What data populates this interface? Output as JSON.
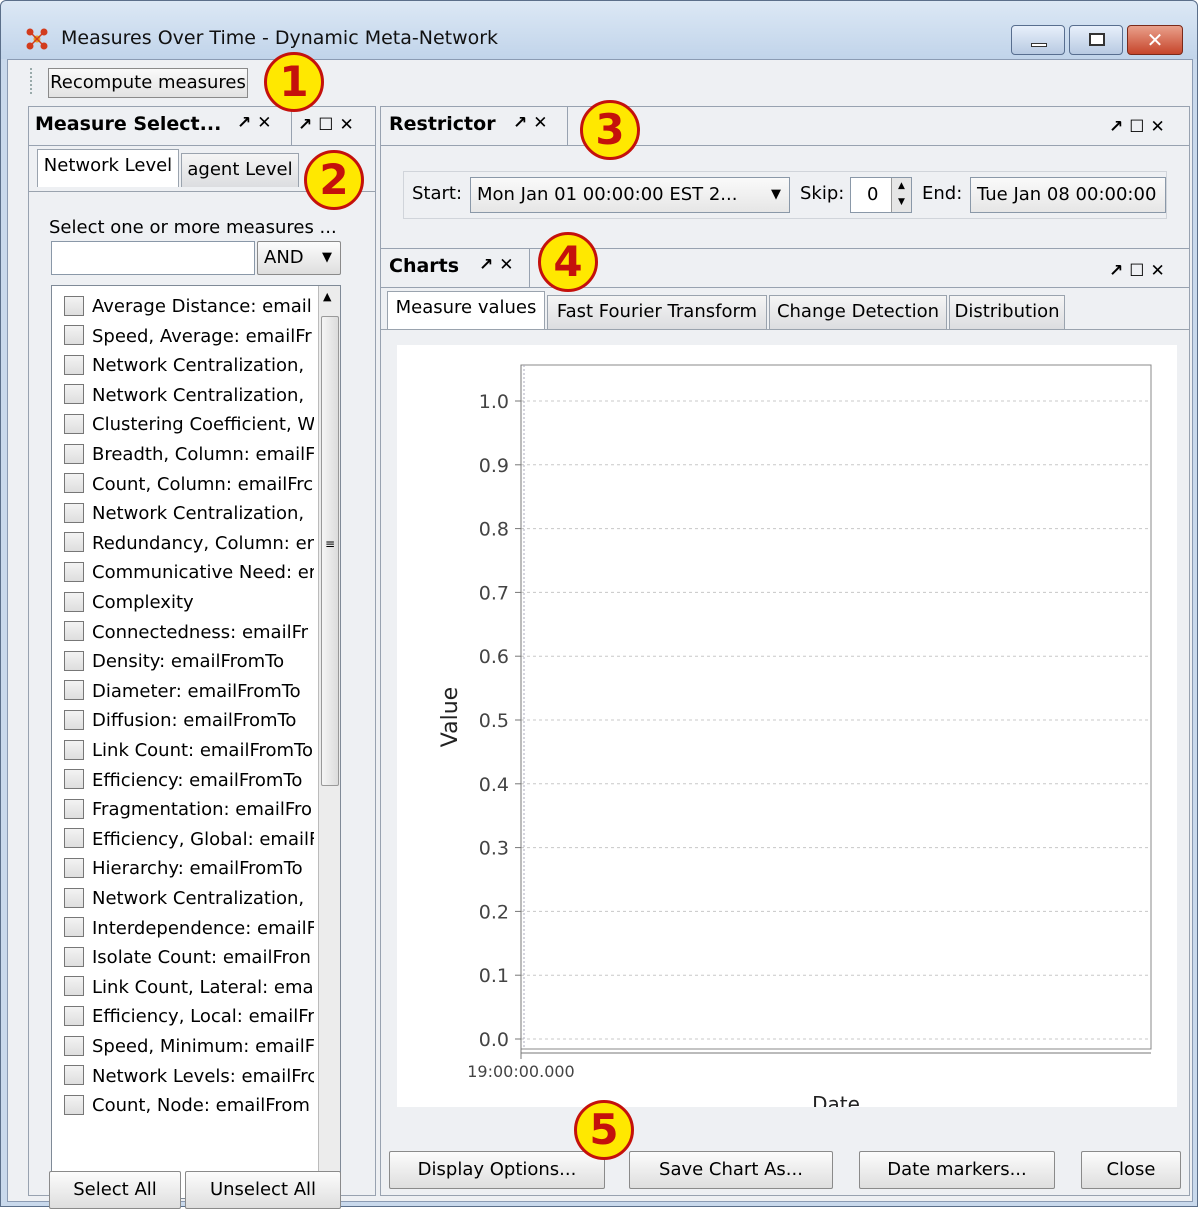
{
  "window": {
    "title": "Measures Over Time - Dynamic Meta-Network",
    "minimize_icon": "minimize-icon",
    "maximize_icon": "maximize-icon",
    "close_icon": "close-icon"
  },
  "toolbar": {
    "recompute_label": "Recompute measures"
  },
  "badges": [
    "1",
    "2",
    "3",
    "4",
    "5"
  ],
  "measure_panel": {
    "title": "Measure Select...",
    "tabs": [
      "Network Level",
      "agent Level"
    ],
    "hint": "Select one or more measures ...",
    "filter_value": "",
    "operator": "AND",
    "measures": [
      "Average Distance: email",
      "Speed, Average: emailFr",
      "Network Centralization,",
      "Network Centralization,",
      "Clustering Coefficient, W",
      "Breadth, Column: emailF",
      "Count, Column: emailFrc",
      "Network Centralization,",
      "Redundancy, Column: er",
      "Communicative Need: er",
      "Complexity",
      "Connectedness: emailFr",
      "Density: emailFromTo",
      "Diameter: emailFromTo",
      "Diffusion: emailFromTo",
      "Link Count: emailFromTo",
      "Efficiency: emailFromTo",
      "Fragmentation: emailFro",
      "Efficiency, Global: emailF",
      "Hierarchy: emailFromTo",
      "Network Centralization,",
      "Interdependence: emailF",
      "Isolate Count: emailFron",
      "Link Count, Lateral: ema",
      "Efficiency, Local: emailFr",
      "Speed, Minimum: emailFr",
      "Network Levels: emailFrc",
      "Count, Node: emailFrom"
    ],
    "select_all": "Select All",
    "unselect_all": "Unselect All"
  },
  "restrictor": {
    "title": "Restrictor",
    "start_label": "Start:",
    "start_value": "Mon Jan 01 00:00:00 EST 2...",
    "skip_label": "Skip:",
    "skip_value": "0",
    "end_label": "End:",
    "end_value": "Tue Jan 08 00:00:00"
  },
  "charts": {
    "title": "Charts",
    "tabs": [
      "Measure values",
      "Fast Fourier Transform",
      "Change Detection",
      "Distribution"
    ],
    "buttons": {
      "display_options": "Display Options...",
      "save_chart": "Save Chart As...",
      "date_markers": "Date markers...",
      "close": "Close"
    }
  },
  "chart_data": {
    "type": "line",
    "title": "",
    "xlabel": "Date",
    "ylabel": "Value",
    "x_ticks": [
      "19:00:00.000"
    ],
    "y_ticks": [
      "0.0",
      "0.1",
      "0.2",
      "0.3",
      "0.4",
      "0.5",
      "0.6",
      "0.7",
      "0.8",
      "0.9",
      "1.0"
    ],
    "ylim": [
      0,
      1.0
    ],
    "series": [],
    "grid": true
  }
}
